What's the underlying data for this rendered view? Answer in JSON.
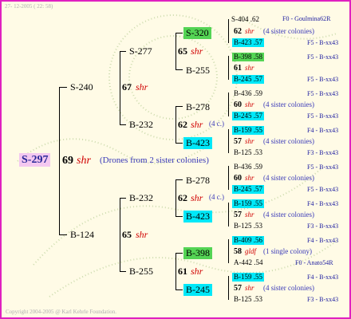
{
  "header": {
    "date": "27- 12-2005 ( 22: 58)"
  },
  "footer": {
    "copyright": "Copyright 2004-2005 @ Karl Kehrle Foundation."
  },
  "root": {
    "id": "S-297",
    "num": "69",
    "race": "shr",
    "note": "(Drones from 2 sister colonies)"
  },
  "gen1": [
    {
      "id": "S-240",
      "num": "67",
      "race": "shr"
    },
    {
      "id": "B-124",
      "num": "65",
      "race": "shr"
    }
  ],
  "gen2": [
    {
      "id": "S-277",
      "num": "65",
      "race": "shr"
    },
    {
      "id": "B-232",
      "num": "62",
      "race": "shr",
      "note": "(4 c.)"
    },
    {
      "id": "B-232",
      "num": "62",
      "race": "shr",
      "note": "(4 c.)"
    },
    {
      "id": "B-255",
      "num": "61",
      "race": "shr"
    }
  ],
  "gen3": [
    {
      "id": "S-320"
    },
    {
      "id": "B-255"
    },
    {
      "id": "B-278"
    },
    {
      "id": "B-423"
    },
    {
      "id": "B-278"
    },
    {
      "id": "B-423"
    },
    {
      "id": "B-398"
    },
    {
      "id": "B-245"
    }
  ],
  "gen4": [
    {
      "sire": "S-404 .62",
      "num": "62",
      "race": "shr",
      "dam": "B-423 .57",
      "note": "(4 sister colonies)",
      "r1": "F0 - Goulmina62R",
      "r3": "F5 - B-xx43"
    },
    {
      "sire": "B-398 .58",
      "num": "61",
      "race": "shr",
      "dam": "B-245 .57",
      "note": "",
      "r1": "F5 - B-xx43",
      "r3": "F5 - B-xx43"
    },
    {
      "sire": "B-436 .59",
      "num": "60",
      "race": "shr",
      "dam": "B-245 .57",
      "note": "(4 sister colonies)",
      "r1": "F5 - B-xx43",
      "r3": "F5 - B-xx43"
    },
    {
      "sire": "B-159 .55",
      "num": "57",
      "race": "shr",
      "dam": "B-125 .53",
      "note": "(4 sister colonies)",
      "r1": "F4 - B-xx43",
      "r3": "F3 - B-xx43"
    },
    {
      "sire": "B-436 .59",
      "num": "60",
      "race": "shr",
      "dam": "B-245 .57",
      "note": "(4 sister colonies)",
      "r1": "F5 - B-xx43",
      "r3": "F5 - B-xx43"
    },
    {
      "sire": "B-159 .55",
      "num": "57",
      "race": "shr",
      "dam": "B-125 .53",
      "note": "(4 sister colonies)",
      "r1": "F4 - B-xx43",
      "r3": "F3 - B-xx43"
    },
    {
      "sire": "B-409 .56",
      "num": "58",
      "race": "gldf",
      "dam": "A-442 .54",
      "note": "(1 single colony)",
      "r1": "F4 - B-xx43",
      "r3": "F0 - Anato54R"
    },
    {
      "sire": "B-159 .55",
      "num": "57",
      "race": "shr",
      "dam": "B-125 .53",
      "note": "(4 sister colonies)",
      "r1": "F4 - B-xx43",
      "r3": "F3 - B-xx43"
    }
  ],
  "colors": {
    "frame": "#e020c0",
    "cyan": "#00e8f8",
    "green": "#54d454",
    "race": "#d00000",
    "root_bg": "#f4c8f0"
  }
}
